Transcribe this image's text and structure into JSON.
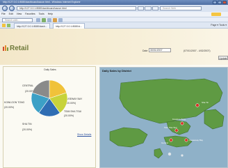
{
  "browser": {
    "window_title": "http://127.0.0.1:8080/dashboard/cause.html - Windows Internet Explorer",
    "address": "http://127.0.0.1:8080/dashboard/cause.html",
    "search_placeholder": "Search Web",
    "menu": [
      "File",
      "Edit",
      "View",
      "Favorites",
      "Tools",
      "Help"
    ],
    "toolbar_search_placeholder": "Search web...",
    "tabs": [
      "http://127.0.0.1:8080/dash...",
      "http://127.0.0.1:8080/d..."
    ],
    "page_tools": "Page ▾  Tools ▾"
  },
  "header": {
    "brand": "Retail",
    "date_label": "Date",
    "date_value": "30/01/2007",
    "date_range": "(07/01/2007 - 4/02/2007)",
    "update_label": "Update"
  },
  "pie": {
    "title": "Daily Sales",
    "show_details": "Show Details",
    "colors": [
      "#f0c23a",
      "#c7d33a",
      "#2f6db3",
      "#3ca0c6",
      "#8a8a8a"
    ],
    "labels": [
      {
        "name": "CENTRAL",
        "pct": "(20.00%)"
      },
      {
        "name": "CAUSEWAY BAY",
        "pct": "(20.00%)"
      },
      {
        "name": "KOWLOON TONG",
        "pct": "(20.00%)"
      },
      {
        "name": "TSIM SHA TSUI",
        "pct": "(20.00%)"
      },
      {
        "name": "SHA TIN",
        "pct": "(20.00%)"
      }
    ]
  },
  "chart_data": {
    "type": "pie",
    "title": "Daily Sales",
    "categories": [
      "CENTRAL",
      "CAUSEWAY BAY",
      "TSIM SHA TSUI",
      "SHA TIN",
      "KOWLOON TONG"
    ],
    "values": [
      20.0,
      20.0,
      20.0,
      20.0,
      20.0
    ]
  },
  "map": {
    "title": "Daily Sales by District",
    "marker_color": "#d8332a",
    "markers": [
      {
        "label": "Sha Tin"
      },
      {
        "label": "Kowloon Tong"
      },
      {
        "label": "Tsim Sha Tsui"
      },
      {
        "label": "Central"
      },
      {
        "label": "Causeway Bay"
      }
    ]
  }
}
